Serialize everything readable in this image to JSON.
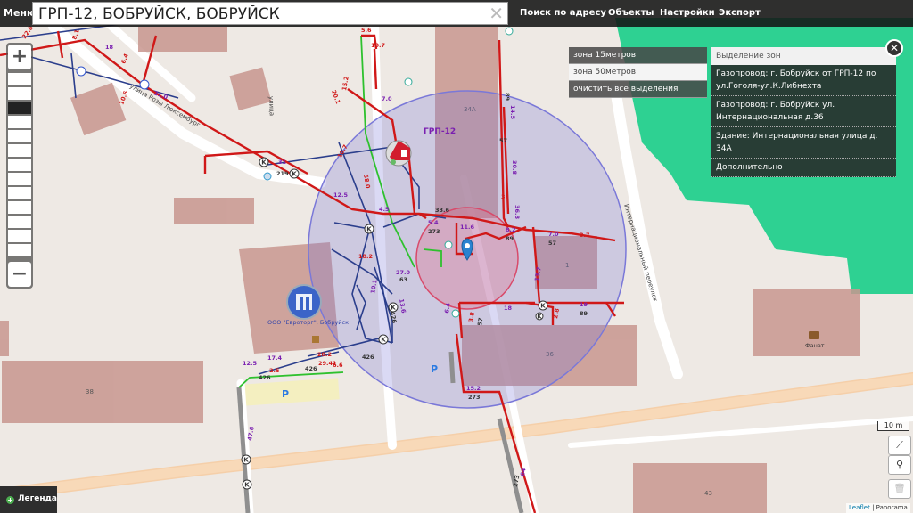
{
  "topbar": {
    "menu_label": "Меню",
    "search_value": "ГРП-12, БОБРУЙСК, БОБРУЙСК",
    "nav": [
      {
        "label": "Поиск по адресу"
      },
      {
        "label": "Объекты"
      },
      {
        "label": "Настройки"
      },
      {
        "label": "Экспорт"
      }
    ]
  },
  "zones": {
    "items": [
      {
        "label": "зона 15метров"
      },
      {
        "label": "зона 50метров"
      },
      {
        "label": "очистить все выделения"
      }
    ]
  },
  "info_panel": {
    "title": "Выделение зон",
    "items": [
      {
        "label": "Газопровод: г. Бобруйск от ГРП-12 по ул.Гоголя-ул.К.Либнехта"
      },
      {
        "label": "Газопровод: г. Бобруйск ул. Интернациональная д.36"
      },
      {
        "label": "Здание: Интернациональная улица д. 34А"
      },
      {
        "label": "Дополнительно"
      }
    ]
  },
  "map": {
    "grp_label": "ГРП-12",
    "company_label": "ООО \"Евроторг\", Бобруйск",
    "fanat_label": "Фанат",
    "street_rosa": "улица Розы Люксембург",
    "street_intl": "Интернациональный переулок",
    "street_ul": "улица",
    "building_numbers": {
      "b34a": "34А",
      "b36": "36",
      "b38": "38",
      "b1": "1",
      "b43": "43"
    },
    "parking": "P",
    "pipe_labels": [
      {
        "t": "22.8"
      },
      {
        "t": "8.1"
      },
      {
        "t": "6.4"
      },
      {
        "t": "18"
      },
      {
        "t": "21.0"
      },
      {
        "t": "10.6"
      },
      {
        "t": "5.6"
      },
      {
        "t": "10.7"
      },
      {
        "t": "20.1"
      },
      {
        "t": "15.2"
      },
      {
        "t": "7.0"
      },
      {
        "t": "31"
      },
      {
        "t": "219"
      },
      {
        "t": "12.5"
      },
      {
        "t": "10.7"
      },
      {
        "t": "58.0"
      },
      {
        "t": "4.5"
      },
      {
        "t": "27.0"
      },
      {
        "t": "18.2"
      },
      {
        "t": "5.4"
      },
      {
        "t": "273"
      },
      {
        "t": "11.6"
      },
      {
        "t": "8.2"
      },
      {
        "t": "89"
      },
      {
        "t": "7.0"
      },
      {
        "t": "57"
      },
      {
        "t": "3.7"
      },
      {
        "t": "14.5"
      },
      {
        "t": "30.8"
      },
      {
        "t": "57"
      },
      {
        "t": "3"
      },
      {
        "t": "89"
      },
      {
        "t": "36.8"
      },
      {
        "t": "33.6"
      },
      {
        "t": "10.1"
      },
      {
        "t": "13.6"
      },
      {
        "t": "426"
      },
      {
        "t": "6.4"
      },
      {
        "t": "63"
      },
      {
        "t": "18"
      },
      {
        "t": "19"
      },
      {
        "t": "89"
      },
      {
        "t": "2.8"
      },
      {
        "t": "3.8"
      },
      {
        "t": "57"
      },
      {
        "t": "13.7"
      },
      {
        "t": "12.5"
      },
      {
        "t": "17.4"
      },
      {
        "t": "28.2"
      },
      {
        "t": "2.5"
      },
      {
        "t": "426"
      },
      {
        "t": "15.2"
      },
      {
        "t": "273"
      },
      {
        "t": "47.6"
      },
      {
        "t": "64"
      },
      {
        "t": "273"
      },
      {
        "t": "29.41"
      },
      {
        "t": "426"
      },
      {
        "t": "6.6"
      },
      {
        "t": "426"
      }
    ]
  },
  "tools": {
    "scale_label": "10 m",
    "attribution_leaflet": "Leaflet",
    "attribution_sep": " | ",
    "attribution_panorama": "Panorama"
  },
  "legend": {
    "label": "Легенда",
    "icon": "+"
  },
  "colors": {
    "pipe_red": "#d01818",
    "pipe_blue": "#2b3e8c",
    "pipe_green": "#2ec12e",
    "pipe_gray": "#8f8f8f",
    "building": "#c8968f",
    "park": "#2ecf91",
    "zone_outer": "#7a78d8",
    "zone_inner": "#e06a86"
  }
}
